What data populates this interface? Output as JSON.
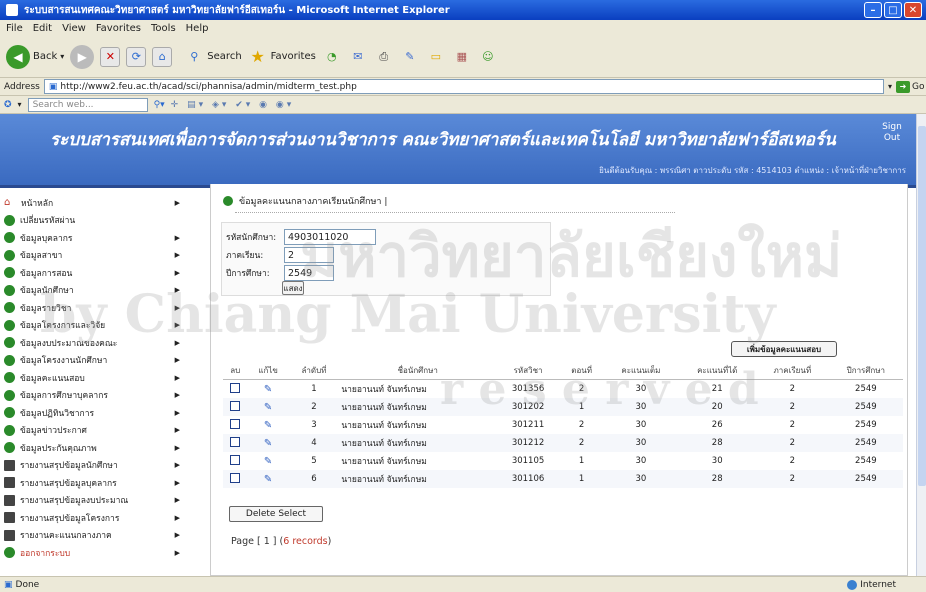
{
  "window": {
    "title": "ระบบสารสนเทศคณะวิทยาศาสตร์ มหาวิทยาลัยฟาร์อีสเทอร์น - Microsoft Internet Explorer"
  },
  "menu": [
    "File",
    "Edit",
    "View",
    "Favorites",
    "Tools",
    "Help"
  ],
  "toolbar": {
    "back": "Back",
    "search": "Search",
    "favorites": "Favorites"
  },
  "address": {
    "label": "Address",
    "url": "http://www2.feu.ac.th/acad/sci/phannisa/admin/midterm_test.php",
    "go": "Go"
  },
  "searchweb": {
    "placeholder": "Search web..."
  },
  "banner": {
    "title": "ระบบสารสนเทศเพื่อการจัดการส่วนงานวิชาการ คณะวิทยาศาสตร์และเทคโนโลยี มหาวิทยาลัยฟาร์อีสเทอร์น",
    "signout": "Sign Out",
    "user": "ยินดีต้อนรับคุณ : พรรณิศา ตาวประดับ รหัส : 4514103 ตำแหน่ง : เจ้าหน้าที่ฝ่ายวิชาการ"
  },
  "sidebar": [
    {
      "label": "หน้าหลัก",
      "icon": "home-icon"
    },
    {
      "label": "เปลี่ยนรหัสผ่าน",
      "icon": "green-circle-icon"
    },
    {
      "label": "ข้อมูลบุคลากร",
      "icon": "green-circle-icon"
    },
    {
      "label": "ข้อมูลสาขา",
      "icon": "green-circle-icon"
    },
    {
      "label": "ข้อมูลการสอน",
      "icon": "green-circle-icon"
    },
    {
      "label": "ข้อมูลนักศึกษา",
      "icon": "green-circle-icon"
    },
    {
      "label": "ข้อมูลรายวิชา",
      "icon": "green-circle-icon"
    },
    {
      "label": "ข้อมูลโครงการและวิจัย",
      "icon": "green-circle-icon"
    },
    {
      "label": "ข้อมูลงบประมาณของคณะ",
      "icon": "green-circle-icon"
    },
    {
      "label": "ข้อมูลโครงงานนักศึกษา",
      "icon": "green-circle-icon"
    },
    {
      "label": "ข้อมูลคะแนนสอบ",
      "icon": "green-circle-icon"
    },
    {
      "label": "ข้อมูลการศึกษาบุคลากร",
      "icon": "green-circle-icon"
    },
    {
      "label": "ข้อมูลปฏิทินวิชาการ",
      "icon": "green-circle-icon"
    },
    {
      "label": "ข้อมูลข่าวประกาศ",
      "icon": "green-circle-icon"
    },
    {
      "label": "ข้อมูลประกันคุณภาพ",
      "icon": "green-circle-icon"
    },
    {
      "label": "รายงานสรุปข้อมูลนักศึกษา",
      "icon": "book-icon"
    },
    {
      "label": "รายงานสรุปข้อมูลบุคลากร",
      "icon": "book-icon"
    },
    {
      "label": "รายงานสรุปข้อมูลงบประมาณ",
      "icon": "book-icon"
    },
    {
      "label": "รายงานสรุปข้อมูลโครงการ",
      "icon": "book-icon"
    },
    {
      "label": "รายงานคะแนนกลางภาค",
      "icon": "book-icon"
    },
    {
      "label": "ออกจากระบบ",
      "icon": "green-circle-icon"
    }
  ],
  "main": {
    "heading": "ข้อมูลคะแนนกลางภาคเรียนนักศึกษา |",
    "form": {
      "student_label": "รหัสนักศึกษา:",
      "student_value": "4903011020",
      "term_label": "ภาคเรียน:",
      "term_value": "2",
      "year_label": "ปีการศึกษา:",
      "year_value": "2549",
      "show_label": "แสดง"
    },
    "add_label": "เพิ่มข้อมูลคะแนนสอบ",
    "columns": [
      "ลบ",
      "แก้ไข",
      "ลำดับที่",
      "ชื่อนักศึกษา",
      "รหัสวิชา",
      "ตอนที่",
      "คะแนนเต็ม",
      "คะแนนที่ได้",
      "ภาคเรียนที่",
      "ปีการศึกษา"
    ],
    "rows": [
      [
        "1",
        "นายอานนท์ จันทร์เกษม",
        "301356",
        "2",
        "30",
        "21",
        "2",
        "2549"
      ],
      [
        "2",
        "นายอานนท์ จันทร์เกษม",
        "301202",
        "1",
        "30",
        "20",
        "2",
        "2549"
      ],
      [
        "3",
        "นายอานนท์ จันทร์เกษม",
        "301211",
        "2",
        "30",
        "26",
        "2",
        "2549"
      ],
      [
        "4",
        "นายอานนท์ จันทร์เกษม",
        "301212",
        "2",
        "30",
        "28",
        "2",
        "2549"
      ],
      [
        "5",
        "นายอานนท์ จันทร์เกษม",
        "301105",
        "1",
        "30",
        "30",
        "2",
        "2549"
      ],
      [
        "6",
        "นายอานนท์ จันทร์เกษม",
        "301106",
        "1",
        "30",
        "28",
        "2",
        "2549"
      ]
    ],
    "delete_label": "Delete Select",
    "pager_prefix": "Page [ 1 ] (",
    "pager_count": "6 records",
    "pager_suffix": ")"
  },
  "status": {
    "left": "Done",
    "right": "Internet"
  },
  "watermark": {
    "line1": "มหาวิทยาลัยเชียงใหม่",
    "line2": "by Chiang Mai University",
    "line3": "r e s e r v e d"
  }
}
